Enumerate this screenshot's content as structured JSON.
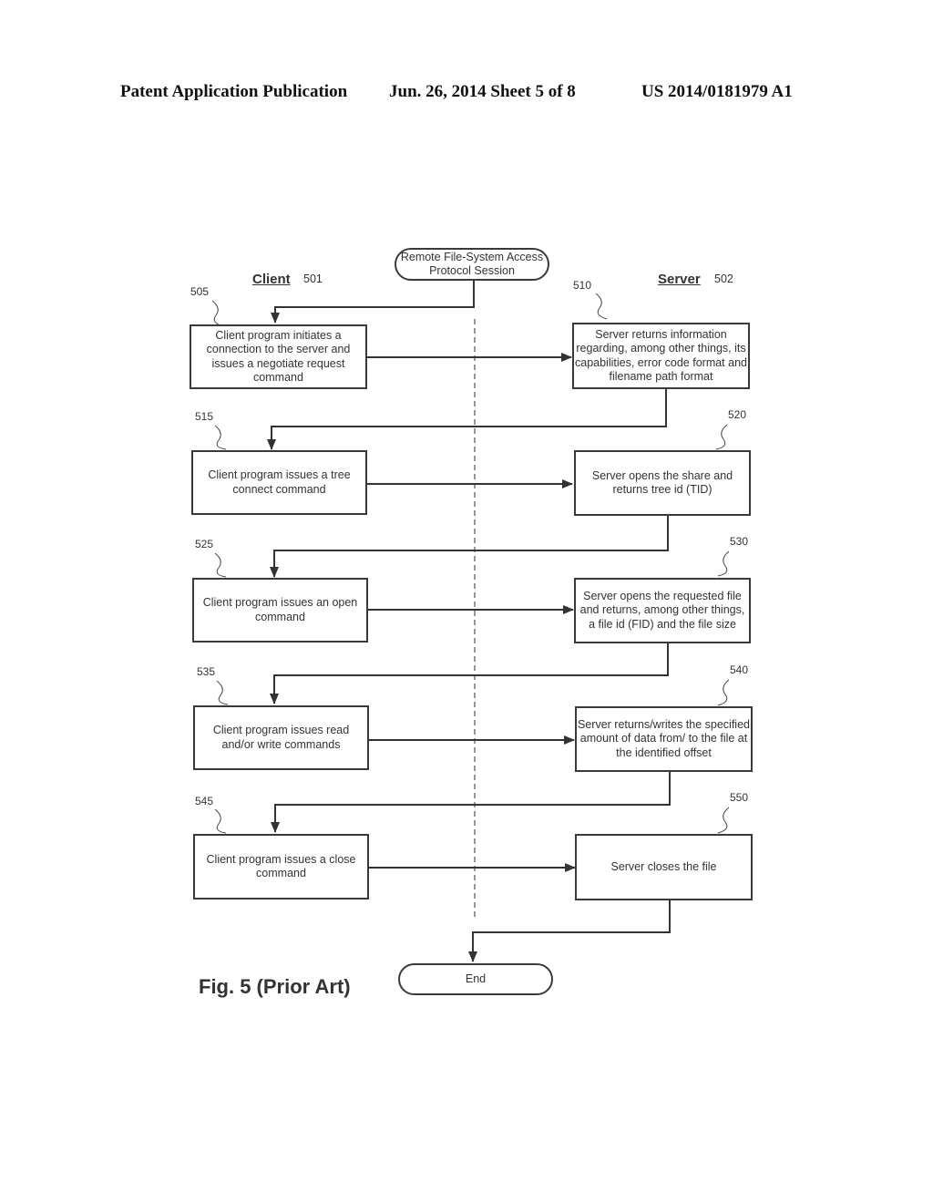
{
  "header": {
    "publication": "Patent Application Publication",
    "date_sheet": "Jun. 26, 2014  Sheet 5 of 8",
    "number": "US 2014/0181979 A1"
  },
  "diagram": {
    "start": "Remote File-System Access Protocol Session",
    "end": "End",
    "lanes": {
      "client": {
        "label": "Client",
        "ref": "501"
      },
      "server": {
        "label": "Server",
        "ref": "502"
      }
    },
    "client_steps": [
      {
        "ref": "505",
        "text": "Client program initiates a connection to the server and issues a negotiate request command"
      },
      {
        "ref": "515",
        "text": "Client program issues a tree connect command"
      },
      {
        "ref": "525",
        "text": "Client program issues an open command"
      },
      {
        "ref": "535",
        "text": "Client program issues read and/or write commands"
      },
      {
        "ref": "545",
        "text": "Client program issues a close command"
      }
    ],
    "server_steps": [
      {
        "ref": "510",
        "text": "Server returns information regarding, among other things, its capabilities, error code format and filename path format"
      },
      {
        "ref": "520",
        "text": "Server opens the share and returns tree id (TID)"
      },
      {
        "ref": "530",
        "text": "Server opens the requested file and returns, among other things, a file id (FID) and the file size"
      },
      {
        "ref": "540",
        "text": "Server returns/writes the specified amount of data from/ to the file at the identified offset"
      },
      {
        "ref": "550",
        "text": "Server closes the file"
      }
    ],
    "caption": "Fig. 5 (Prior Art)"
  }
}
